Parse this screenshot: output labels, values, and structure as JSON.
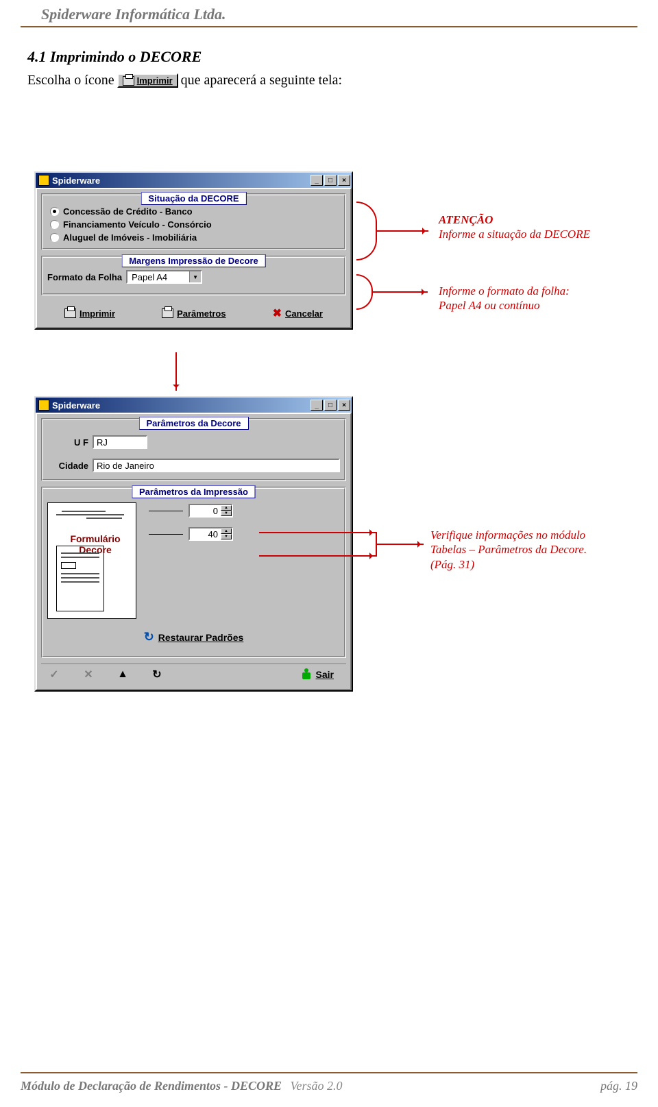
{
  "header": {
    "company": "Spiderware Informática Ltda."
  },
  "section": {
    "title": "4.1 Imprimindo o DECORE",
    "line_before": "Escolha o ícone ",
    "line_after": " que aparecerá a seguinte tela:",
    "imprimir_label": "Imprimir"
  },
  "window1": {
    "title": "Spiderware",
    "group_situacao": "Situação da DECORE",
    "radio1": "Concessão de Crédito - Banco",
    "radio2": "Financiamento Veículo - Consórcio",
    "radio3": "Aluguel de Imóveis - Imobiliária",
    "group_margens": "Margens Impressão de Decore",
    "formato_label": "Formato da Folha",
    "formato_value": "Papel A4",
    "btn_imprimir": "Imprimir",
    "btn_parametros": "Parâmetros",
    "btn_cancelar": "Cancelar"
  },
  "window2": {
    "title": "Spiderware",
    "group_param_decore": "Parâmetros da Decore",
    "uf_label": "U F",
    "uf_value": "RJ",
    "cidade_label": "Cidade",
    "cidade_value": "Rio de Janeiro",
    "group_param_imp": "Parâmetros da Impressão",
    "spin1": "0",
    "spin2": "40",
    "formulario_label1": "Formulário",
    "formulario_label2": "Decore",
    "btn_restaurar": "Restaurar Padrões",
    "btn_sair": "Sair"
  },
  "annotations": {
    "atencao_title": "ATENÇÃO",
    "atencao_body": "Informe a situação da DECORE",
    "formato_line1": "Informe o formato da folha:",
    "formato_line2": "Papel A4 ou contínuo",
    "verif_line1": "Verifique informações no módulo",
    "verif_line2": "Tabelas – Parâmetros da Decore.",
    "verif_line3": "(Pág. 31)"
  },
  "footer": {
    "left": "Módulo de Declaração de Rendimentos - DECORE",
    "version": "Versão 2.0",
    "page": "pág. 19"
  }
}
